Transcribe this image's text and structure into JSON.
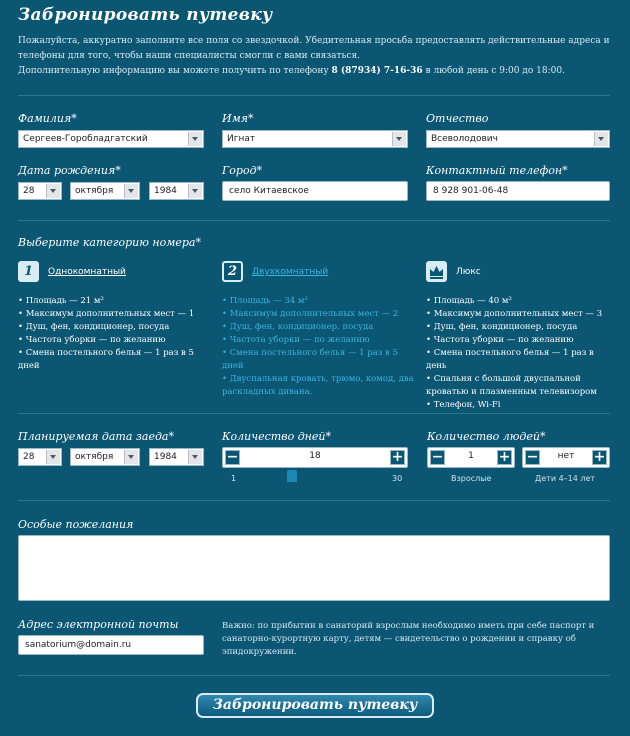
{
  "header": {
    "title": "Забронировать путевку",
    "intro": "Пожалуйста, аккуратно заполните все поля со звездочкой. Убедительная просьба предоставлять действительные адреса и телефоны для того, чтобы наши специалисты смогли с вами связаться.",
    "phone_prefix": "Дополнительную информацию вы можете получить по телефону",
    "phone": "8 (87934) 7-16-36",
    "phone_suffix": "в любой день с 9:00 до 18:00."
  },
  "personal": {
    "surname_label": "Фамилия*",
    "surname_value": "Сергеев-Горобладгатский",
    "name_label": "Имя*",
    "name_value": "Игнат",
    "patronymic_label": "Отчество",
    "patronymic_value": "Всеволодович",
    "birth_label": "Дата рождения*",
    "birth_day": "28",
    "birth_month": "октября",
    "birth_year": "1984",
    "city_label": "Город*",
    "city_value": "село Китаевское",
    "phone_label": "Контактный телефон*",
    "phone_value": "8 928 901-06-48"
  },
  "category": {
    "heading": "Выберите категорию номера*",
    "options": [
      {
        "badge": "1",
        "name": "Однокомнатный",
        "features": [
          "Площадь — 21 м²",
          "Максимум дополнительных мест — 1",
          "Душ, фен, кондиционер, посуда",
          "Частота уборки — по желанию",
          "Смена постельного белья — 1 раз в 5 дней"
        ]
      },
      {
        "badge": "2",
        "name": "Двухкомнатный",
        "features": [
          "Площадь — 34 м²",
          "Максимум дополнительных мест — 2",
          "Душ, фен, кондиционер, посуда",
          "Частота уборки — по желанию",
          "Смена постельного белья — 1 раз в 5 дней",
          "Двуспальная кровать, трюмо, комод, два раскладных дивана."
        ]
      },
      {
        "badge": "crown",
        "name": "Люкс",
        "features": [
          "Площадь — 40 м²",
          "Максимум дополнительных мест — 3",
          "Душ, фен, кондиционер, посуда",
          "Частота уборки — по желанию",
          "Смена постельного белья — 1 раз в день",
          "Спальня с большой двуспальной кроватью и плазменным телевизором",
          "Телефон, Wi-Fi"
        ]
      }
    ],
    "selected_index": 1,
    "selected_color": "#3ab4e0"
  },
  "stay": {
    "arrival_label": "Планируемая дата заеда*",
    "arrival_day": "28",
    "arrival_month": "октября",
    "arrival_year": "1984",
    "days_label": "Количество дней*",
    "days_value": "18",
    "days_min": "1",
    "days_max": "30",
    "people_label": "Количество людей*",
    "adults_value": "1",
    "adults_caption": "Взрослые",
    "children_value": "нет",
    "children_caption": "Дети 4–14 лет"
  },
  "wishes": {
    "label": "Особые пожелания",
    "value": ""
  },
  "email": {
    "label": "Адрес электронной почты",
    "value": "sanatorium@domain.ru",
    "note": "Важно: по прибытии в санаторий взрослым необходимо иметь при себе паспорт и санаторно-курортную карту, детям — свидетельство о рождении и справку об эпидокружении."
  },
  "submit_label": "Забронировать путевку"
}
